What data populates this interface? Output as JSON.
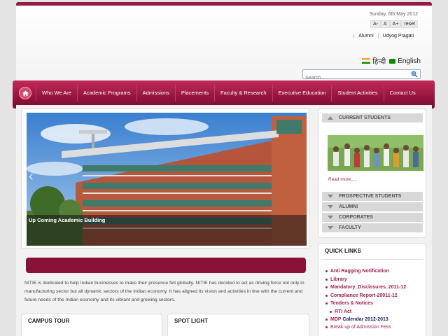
{
  "header": {
    "date": "Sunday, 6th May 2012",
    "text_size": [
      "A-",
      "A",
      "A+",
      "reset"
    ],
    "top_links": [
      "Alumni",
      "Udyog Pragati"
    ],
    "lang_hindi": "हिन्दी",
    "lang_english": "English",
    "search_placeholder": "Search..."
  },
  "nav": {
    "items": [
      "Who We Are",
      "Academic Programs",
      "Admissions",
      "Placements",
      "Faculty & Research",
      "Executive Education",
      "Student Activities",
      "Contact Us"
    ]
  },
  "slider": {
    "caption": "Up Coming Academic Building"
  },
  "mission_text": "NITIE is dedicated to help Indian businesses to make their presence felt globally. NITIE has decided to act as driving force not only in manufacturing sector but all dynamic sectors of the Indian economy. It has aligned its vision and activities in line with the current and future needs of the Indian economy and its vibrant and growing sectors.",
  "boxes": {
    "campus_tour": "CAMPUS TOUR",
    "spot_light": "SPOT LIGHT"
  },
  "sidebar": {
    "current_students": "CURRENT STUDENTS",
    "read_more": "Read more.....",
    "sections": [
      "PROSPECTIVE STUDENTS",
      "ALUMNI",
      "CORPORATES",
      "FACULTY"
    ]
  },
  "quick_links": {
    "title": "QUICK LINKS",
    "items": [
      "Anti Ragging Notification",
      "Library",
      "Mandatory_Disclosures_2011-12",
      "Compliance Report-20011-12",
      "Tenders & Notices",
      "RTI Act",
      "MDP",
      "Calendar 2012-2013",
      "Break up  of Admission Fess"
    ]
  },
  "colors": {
    "brand": "#8e1e40",
    "nav_top": "#c22a5a",
    "link": "#a02050"
  }
}
